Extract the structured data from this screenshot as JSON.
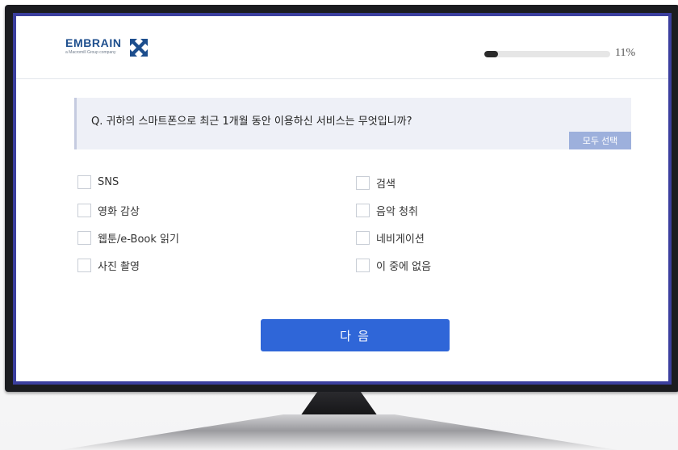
{
  "brand": {
    "name": "EMBRAIN",
    "tagline": "a Macromill Group company",
    "logo_icon": "embrain-arrows-icon",
    "color": "#1d4e8d"
  },
  "progress": {
    "value": 0.11,
    "label": "11%"
  },
  "question": {
    "text": "Q. 귀하의 스마트폰으로 최근 1개월 동안 이용하신 서비스는 무엇입니까?",
    "select_all_label": "모두 선택"
  },
  "options": {
    "left": [
      {
        "label": "SNS",
        "checked": false
      },
      {
        "label": "영화 감상",
        "checked": false
      },
      {
        "label": "웹툰/e-Book 읽기",
        "checked": false
      },
      {
        "label": "사진 촬영",
        "checked": false
      }
    ],
    "right": [
      {
        "label": "검색",
        "checked": false
      },
      {
        "label": "음악 청취",
        "checked": false
      },
      {
        "label": "네비게이션",
        "checked": false
      },
      {
        "label": "이 중에 없음",
        "checked": false
      }
    ]
  },
  "actions": {
    "next_label": "다 음"
  },
  "colors": {
    "accent": "#2f66d8",
    "select_all": "#9db0dc",
    "question_bg": "#eef0f7",
    "tv_frame": "#1b1c20",
    "screen_border": "#3b3f9e"
  }
}
